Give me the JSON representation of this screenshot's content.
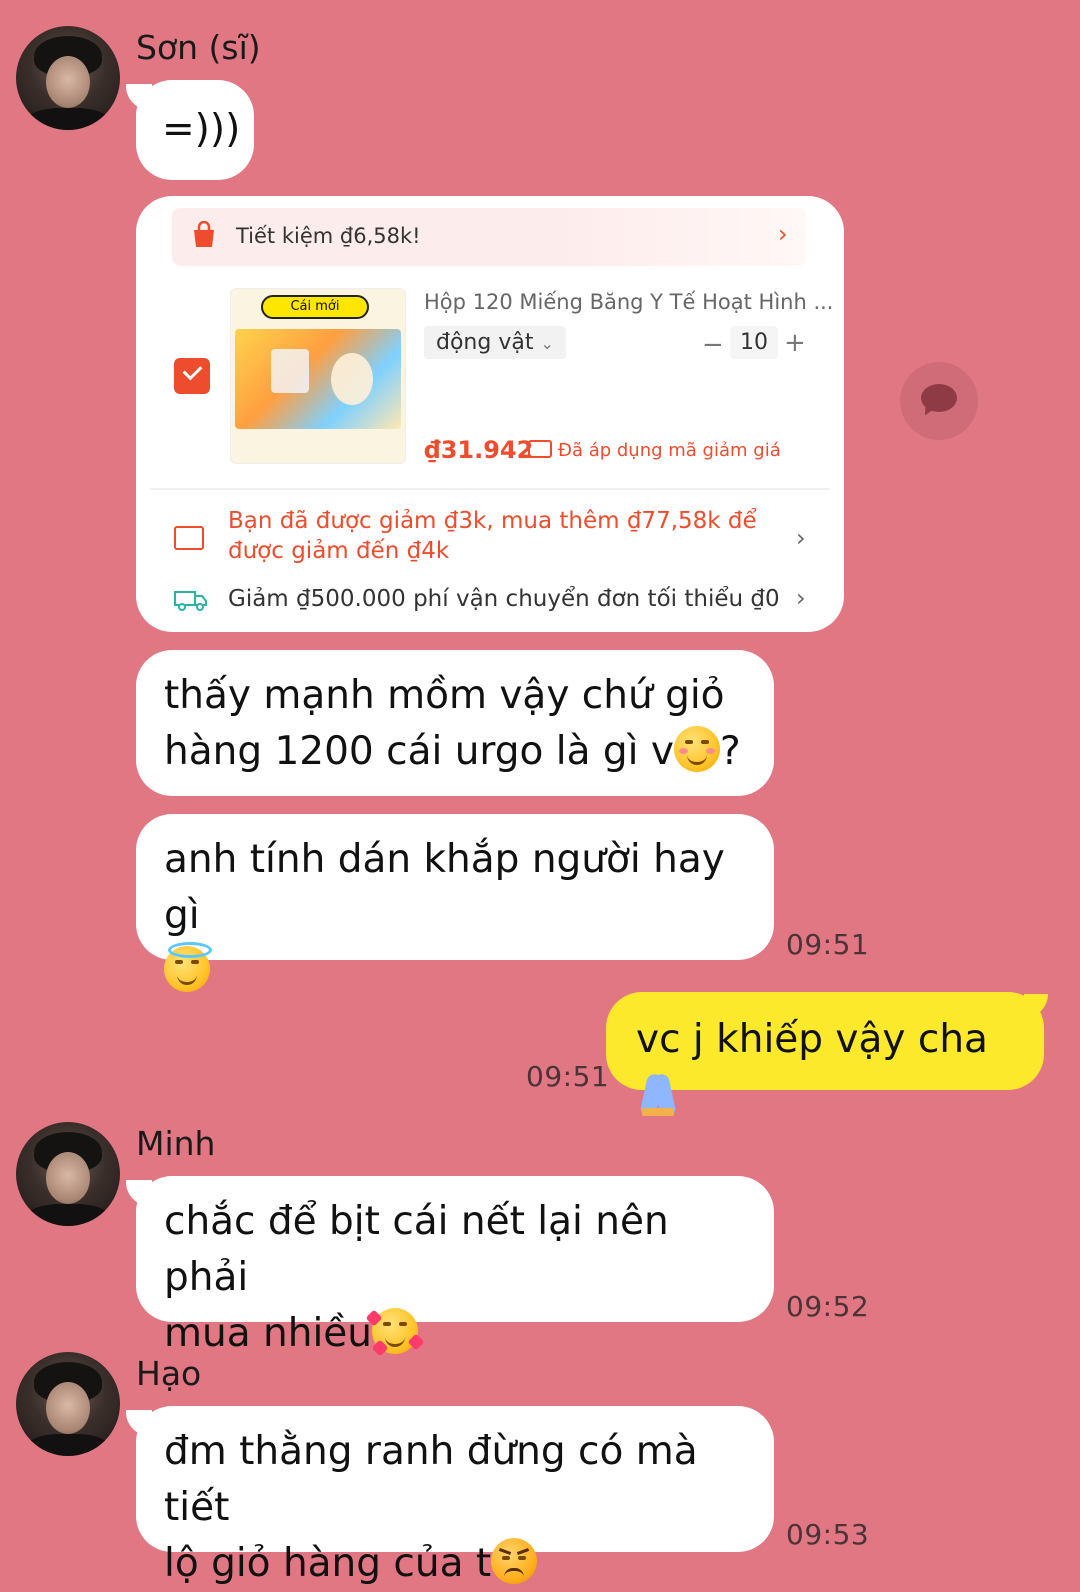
{
  "colors": {
    "background": "#e27784",
    "incoming_bubble": "#ffffff",
    "outgoing_bubble": "#fde92c",
    "shopee_orange": "#ee4d2d"
  },
  "messages": [
    {
      "sender": "Sơn (sĩ)",
      "text": "=)))"
    },
    {
      "product_card": {
        "promo_text": "Tiết kiệm ₫6,58k!",
        "badge": "Cái mới",
        "product_title": "Hộp 120 Miếng Băng Y Tế Hoạt Hình ...",
        "variant": "động vật",
        "quantity": "10",
        "price": "₫31.942",
        "voucher_note": "Đã áp dụng mã giảm giá",
        "discount_line1": "Bạn đã được giảm ₫3k, mua thêm ₫77,58k để",
        "discount_line2": "được giảm đến ₫4k",
        "shipping": "Giảm ₫500.000 phí vận chuyển đơn tối thiểu ₫0"
      }
    },
    {
      "text_line1": "thấy mạnh mồm vậy chứ giỏ",
      "text_line2": "hàng 1200 cái urgo là gì v",
      "text_end": "?",
      "emoji": "smiling-blush-emoji"
    },
    {
      "text_line1": "anh tính dán khắp người hay gì",
      "emoji": "halo-emoji",
      "time": "09:51"
    },
    {
      "outgoing": true,
      "text": "vc j khiếp vậy cha",
      "emoji": "folded-hands-emoji",
      "time": "09:51"
    },
    {
      "sender": "Minh",
      "text_line1": "chắc để bịt cái nết lại nên phải",
      "text_line2": "mua nhiều",
      "emoji": "smiling-hearts-emoji",
      "time": "09:52"
    },
    {
      "sender": "Hạo",
      "text_line1": "đm thằng ranh đừng có mà tiết",
      "text_line2": "lộ giỏ hàng của t",
      "emoji": "angry-emoji",
      "time": "09:53"
    }
  ]
}
